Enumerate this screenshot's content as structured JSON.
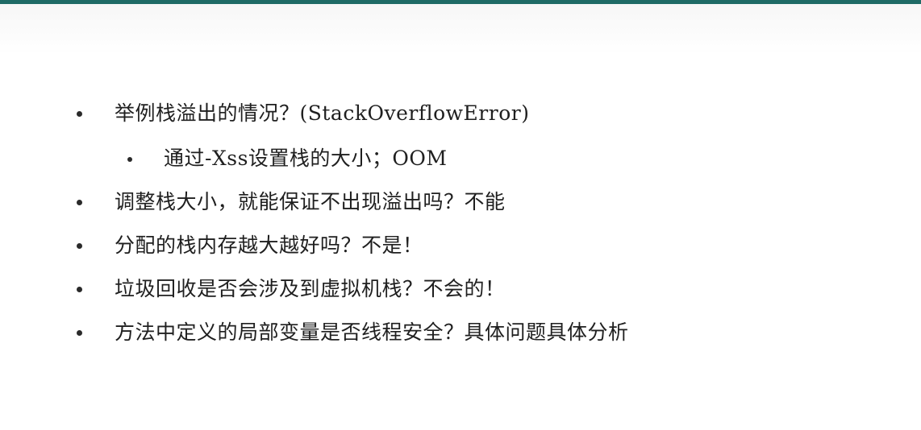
{
  "slide": {
    "items": [
      {
        "level": 1,
        "text": "举例栈溢出的情况？(StackOverflowError)"
      },
      {
        "level": 2,
        "text": "通过-Xss设置栈的大小；OOM"
      },
      {
        "level": 1,
        "text": "调整栈大小，就能保证不出现溢出吗？不能"
      },
      {
        "level": 1,
        "text": "分配的栈内存越大越好吗？不是！"
      },
      {
        "level": 1,
        "text": "垃圾回收是否会涉及到虚拟机栈？不会的！"
      },
      {
        "level": 1,
        "text": "方法中定义的局部变量是否线程安全？具体问题具体分析"
      }
    ]
  },
  "colors": {
    "accent_rule": "#1f6b66",
    "text": "#1f1f1f",
    "background": "#ffffff"
  }
}
